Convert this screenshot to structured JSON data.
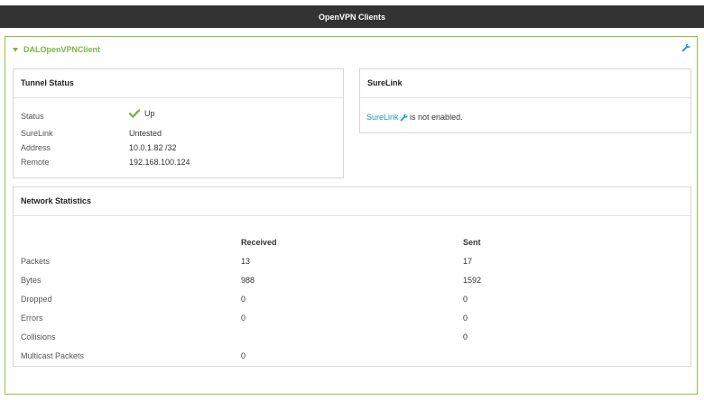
{
  "header": {
    "title": "OpenVPN Clients"
  },
  "client": {
    "name": "DALOpenVPNClient"
  },
  "tunnel_status": {
    "title": "Tunnel Status",
    "rows": [
      {
        "label": "Status",
        "value": "Up"
      },
      {
        "label": "SureLink",
        "value": "Untested"
      },
      {
        "label": "Address",
        "value": "10.0.1.82 /32"
      },
      {
        "label": "Remote",
        "value": "192.168.100.124"
      }
    ]
  },
  "surelink": {
    "title": "SureLink",
    "link_text": "SureLink",
    "message": " is not enabled."
  },
  "network_statistics": {
    "title": "Network Statistics",
    "columns": {
      "received": "Received",
      "sent": "Sent"
    },
    "rows": [
      {
        "label": "Packets",
        "received": "13",
        "sent": "17"
      },
      {
        "label": "Bytes",
        "received": "988",
        "sent": "1592"
      },
      {
        "label": "Dropped",
        "received": "0",
        "sent": "0"
      },
      {
        "label": "Errors",
        "received": "0",
        "sent": "0"
      },
      {
        "label": "Collisions",
        "received": "",
        "sent": "0"
      },
      {
        "label": "Multicast Packets",
        "received": "0",
        "sent": ""
      }
    ]
  },
  "colors": {
    "accent_green": "#7ab648",
    "link_blue": "#1a9ad6",
    "header_bg": "#333333"
  },
  "icons": [
    "collapse-triangle-icon",
    "wrench-icon",
    "checkmark-icon"
  ]
}
